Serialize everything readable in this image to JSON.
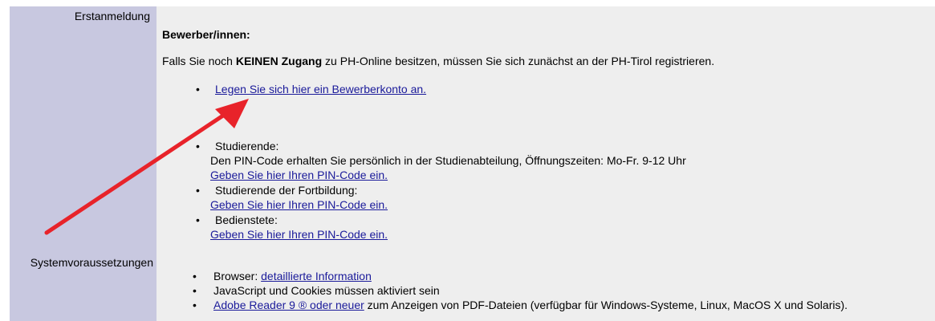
{
  "sidebar": {
    "erstanmeldung": "Erstanmeldung",
    "systemvoraussetzungen": "Systemvoraussetzungen"
  },
  "applicants": {
    "heading": "Bewerber/innen:",
    "intro_prefix": "Falls Sie noch ",
    "intro_bold": "KEINEN Zugang",
    "intro_suffix": " zu PH-Online besitzen, müssen Sie sich zunächst an der PH-Tirol registrieren.",
    "create_account_link": "Legen Sie sich hier ein Bewerberkonto an."
  },
  "groups": [
    {
      "title": "Studierende:",
      "detail": "Den PIN-Code erhalten Sie persönlich in der Studienabteilung, Öffnungszeiten: Mo-Fr. 9-12 Uhr",
      "link": "Geben Sie hier Ihren PIN-Code ein."
    },
    {
      "title": "Studierende der Fortbildung:",
      "link": "Geben Sie hier Ihren PIN-Code ein."
    },
    {
      "title": "Bedienstete:",
      "link": "Geben Sie hier Ihren PIN-Code ein."
    }
  ],
  "system": {
    "browser_prefix": "Browser: ",
    "browser_link": "detaillierte Information",
    "javascript": "JavaScript und Cookies müssen aktiviert sein",
    "reader_link": "Adobe Reader 9 ® oder neuer",
    "reader_suffix": " zum Anzeigen von PDF-Dateien (verfügbar für Windows-Systeme, Linux, MacOS X und Solaris)."
  },
  "bullet_glyph": "•",
  "colors": {
    "sidebar": "#c8c8e0",
    "main": "#eeeeee",
    "link": "#1a1a9a",
    "arrow": "#e8232a"
  }
}
